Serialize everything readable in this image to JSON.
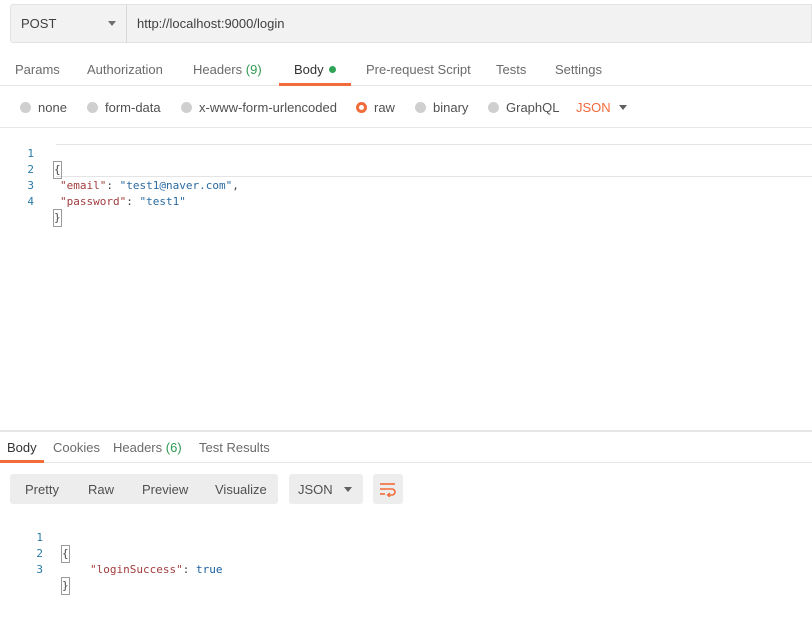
{
  "request": {
    "method": "POST",
    "url": "http://localhost:9000/login"
  },
  "request_tabs": [
    {
      "label": "Params",
      "count": ""
    },
    {
      "label": "Authorization",
      "count": ""
    },
    {
      "label": "Headers",
      "count": "(9)"
    },
    {
      "label": "Body",
      "count": "",
      "active": true,
      "has_dot": true
    },
    {
      "label": "Pre-request Script",
      "count": ""
    },
    {
      "label": "Tests",
      "count": ""
    },
    {
      "label": "Settings",
      "count": ""
    }
  ],
  "body_types": [
    {
      "label": "none",
      "selected": false
    },
    {
      "label": "form-data",
      "selected": false
    },
    {
      "label": "x-www-form-urlencoded",
      "selected": false
    },
    {
      "label": "raw",
      "selected": true
    },
    {
      "label": "binary",
      "selected": false
    },
    {
      "label": "GraphQL",
      "selected": false
    }
  ],
  "raw_language": "JSON",
  "request_body": {
    "line_numbers": [
      "1",
      "2",
      "3",
      "4"
    ],
    "open_brace": "{",
    "close_brace": "}",
    "fields": [
      {
        "key": "\"email\"",
        "sep": ": ",
        "value": "\"test1@naver.com\"",
        "trail": ","
      },
      {
        "key": "\"password\"",
        "sep": ": ",
        "value": "\"test1\"",
        "trail": ""
      }
    ]
  },
  "response_tabs": [
    {
      "label": "Body",
      "count": "",
      "active": true
    },
    {
      "label": "Cookies",
      "count": ""
    },
    {
      "label": "Headers",
      "count": "(6)"
    },
    {
      "label": "Test Results",
      "count": ""
    }
  ],
  "response_views": [
    "Pretty",
    "Raw",
    "Preview",
    "Visualize"
  ],
  "response_format": "JSON",
  "response_body": {
    "line_numbers": [
      "1",
      "2",
      "3"
    ],
    "open_brace": "{",
    "close_brace": "}",
    "key": "\"loginSuccess\"",
    "sep": ": ",
    "value": "true"
  },
  "colors": {
    "accent": "#f26b3a",
    "count_green": "#2f9a53",
    "dot_green": "#2fa457"
  }
}
